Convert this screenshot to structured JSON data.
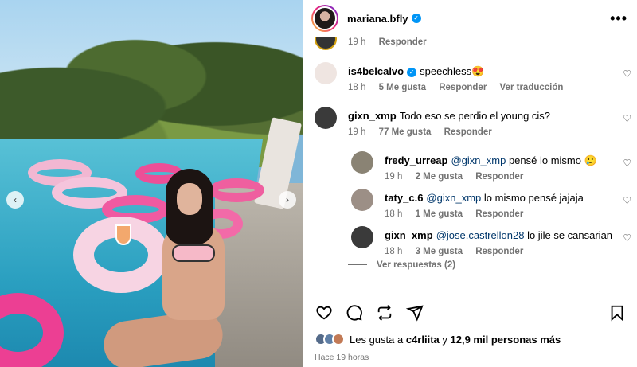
{
  "post": {
    "username": "mariana.bfly",
    "verified": true,
    "more_icon": "•••"
  },
  "carousel": {
    "prev_icon": "‹",
    "next_icon": "›"
  },
  "top_partial": {
    "time": "19 h",
    "reply": "Responder"
  },
  "comments": [
    {
      "username": "is4belcalvo",
      "verified": true,
      "text": "speechless😍",
      "time": "18 h",
      "likes": "5 Me gusta",
      "reply": "Responder",
      "translate": "Ver traducción",
      "avatar_color": "#f0e6e2"
    },
    {
      "username": "gixn_xmp",
      "text": "Todo eso se perdio el young cis?",
      "time": "19 h",
      "likes": "77 Me gusta",
      "reply": "Responder",
      "avatar_color": "#3a3a3a"
    }
  ],
  "replies": [
    {
      "username": "fredy_urreap",
      "mention": "@gixn_xmp",
      "text": "pensé lo mismo 🥲",
      "time": "19 h",
      "likes": "2 Me gusta",
      "reply": "Responder",
      "avatar_color": "#8a8374"
    },
    {
      "username": "taty_c.6",
      "mention": "@gixn_xmp",
      "text": "lo mismo pensé jajaja",
      "time": "18 h",
      "likes": "1 Me gusta",
      "reply": "Responder",
      "avatar_color": "#9c8f86"
    },
    {
      "username": "gixn_xmp",
      "mention": "@jose.castrellon28",
      "text": "lo jile se cansarian",
      "time": "18 h",
      "likes": "3 Me gusta",
      "reply": "Responder",
      "avatar_color": "#3a3a3a"
    }
  ],
  "view_replies": "Ver respuestas (2)",
  "likes_line": {
    "prefix": "Les gusta a",
    "user": "c4rliita",
    "middle": "y",
    "count": "12,9 mil personas más"
  },
  "posted_time": "Hace 19 horas",
  "colors": {
    "verified": "#0095f6",
    "meta": "#737373",
    "mention": "#00376b"
  }
}
